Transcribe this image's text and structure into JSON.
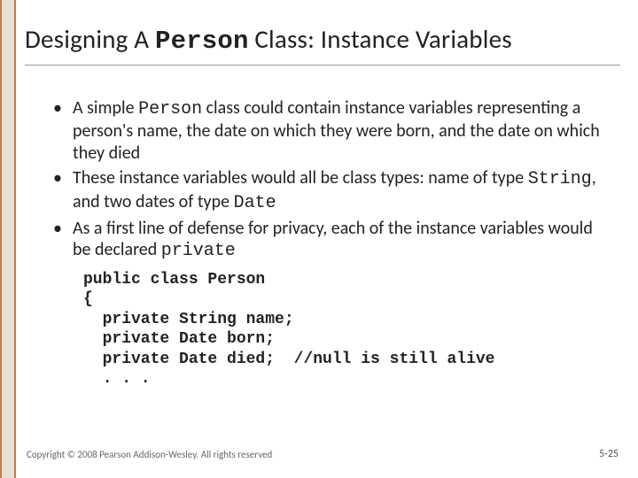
{
  "title": {
    "pre": "Designing A ",
    "mono": "Person",
    "post": " Class:  Instance Variables"
  },
  "bullets": [
    {
      "segments": [
        {
          "t": "A simple ",
          "mono": false
        },
        {
          "t": "Person",
          "mono": true
        },
        {
          "t": " class could contain instance variables representing a person's name, the date on which they were born, and the date on which they died",
          "mono": false
        }
      ]
    },
    {
      "segments": [
        {
          "t": "These instance variables would all be class types:  name of type ",
          "mono": false
        },
        {
          "t": "String",
          "mono": true
        },
        {
          "t": ", and two dates of type ",
          "mono": false
        },
        {
          "t": "Date",
          "mono": true
        }
      ]
    },
    {
      "segments": [
        {
          "t": "As a first line of defense for privacy, each of the instance variables would be declared ",
          "mono": false
        },
        {
          "t": "private",
          "mono": true
        }
      ]
    }
  ],
  "code": "public class Person\n{\n  private String name;\n  private Date born;\n  private Date died;  //null is still alive\n  . . .",
  "footer": "Copyright © 2008 Pearson Addison-Wesley. All rights reserved",
  "pagenum": "5-25"
}
